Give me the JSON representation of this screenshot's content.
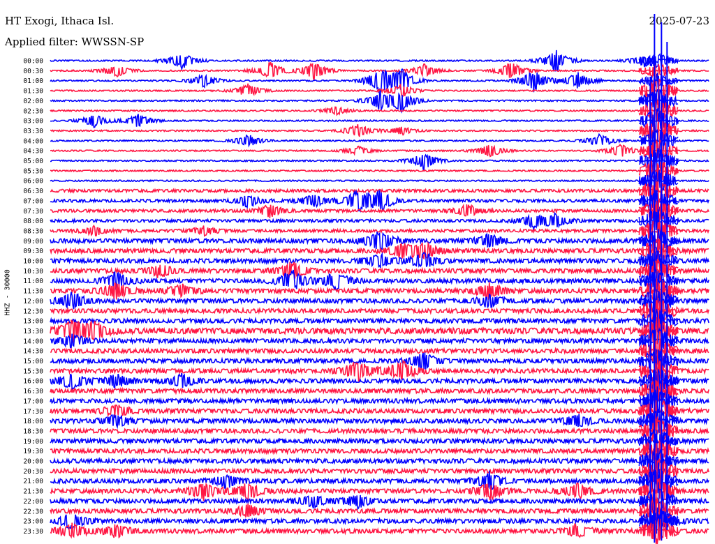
{
  "header": {
    "station": "HT Exogi, Ithaca Isl.",
    "filter": "Applied filter: WWSSN-SP",
    "date": "2025-07-23"
  },
  "side_label": "HHZ - 30000",
  "chart_data": {
    "type": "line",
    "title": "HT Exogi, Ithaca Isl.",
    "subtitle": "Applied filter: WWSSN-SP",
    "date": "2025-07-23",
    "ylabel": "HHZ - 30000",
    "xlabel": "",
    "series_colors": [
      "#0000ff",
      "#ff1744"
    ],
    "rows": [
      "00:00",
      "00:30",
      "01:00",
      "01:30",
      "02:00",
      "02:30",
      "03:00",
      "03:30",
      "04:00",
      "04:30",
      "05:00",
      "05:30",
      "06:00",
      "06:30",
      "07:00",
      "07:30",
      "08:00",
      "08:30",
      "09:00",
      "09:30",
      "10:00",
      "10:30",
      "11:00",
      "11:30",
      "12:00",
      "12:30",
      "13:00",
      "13:30",
      "14:00",
      "14:30",
      "15:00",
      "15:30",
      "16:00",
      "16:30",
      "17:00",
      "17:30",
      "18:00",
      "18:30",
      "19:00",
      "19:30",
      "20:00",
      "20:30",
      "21:00",
      "21:30",
      "22:00",
      "22:30",
      "23:00",
      "23:30"
    ],
    "noise_level": [
      1,
      1,
      1,
      1,
      1,
      1,
      1,
      1,
      1,
      1,
      1,
      1,
      1,
      2,
      2,
      2,
      2,
      2,
      3,
      3,
      3,
      3,
      3,
      3,
      3,
      3,
      3,
      4,
      3,
      3,
      3,
      3,
      3,
      3,
      3,
      3,
      3,
      3,
      3,
      3,
      3,
      3,
      3,
      3,
      3,
      3,
      3,
      3
    ],
    "events": [
      {
        "row": 0,
        "minute": 6,
        "amp": 4
      },
      {
        "row": 0,
        "minute": 23,
        "amp": 5
      },
      {
        "row": 0,
        "minute": 27,
        "amp": 3
      },
      {
        "row": 1,
        "minute": 3,
        "amp": 3
      },
      {
        "row": 1,
        "minute": 10,
        "amp": 4
      },
      {
        "row": 1,
        "minute": 12,
        "amp": 4
      },
      {
        "row": 1,
        "minute": 17,
        "amp": 3
      },
      {
        "row": 1,
        "minute": 21,
        "amp": 4
      },
      {
        "row": 2,
        "minute": 7,
        "amp": 3
      },
      {
        "row": 2,
        "minute": 15,
        "amp": 6
      },
      {
        "row": 2,
        "minute": 16,
        "amp": 5
      },
      {
        "row": 2,
        "minute": 22,
        "amp": 5
      },
      {
        "row": 2,
        "minute": 24,
        "amp": 4
      },
      {
        "row": 3,
        "minute": 9,
        "amp": 3
      },
      {
        "row": 3,
        "minute": 16,
        "amp": 3
      },
      {
        "row": 4,
        "minute": 15,
        "amp": 4
      },
      {
        "row": 4,
        "minute": 16,
        "amp": 5
      },
      {
        "row": 5,
        "minute": 13,
        "amp": 2
      },
      {
        "row": 6,
        "minute": 2,
        "amp": 3
      },
      {
        "row": 6,
        "minute": 4,
        "amp": 3
      },
      {
        "row": 7,
        "minute": 14,
        "amp": 3
      },
      {
        "row": 7,
        "minute": 16,
        "amp": 2
      },
      {
        "row": 8,
        "minute": 9,
        "amp": 3
      },
      {
        "row": 8,
        "minute": 25,
        "amp": 3
      },
      {
        "row": 9,
        "minute": 14,
        "amp": 2
      },
      {
        "row": 9,
        "minute": 20,
        "amp": 3
      },
      {
        "row": 9,
        "minute": 26,
        "amp": 3
      },
      {
        "row": 10,
        "minute": 17,
        "amp": 4
      },
      {
        "row": 14,
        "minute": 9,
        "amp": 3
      },
      {
        "row": 14,
        "minute": 12,
        "amp": 3
      },
      {
        "row": 14,
        "minute": 14,
        "amp": 5
      },
      {
        "row": 14,
        "minute": 15,
        "amp": 5
      },
      {
        "row": 15,
        "minute": 10,
        "amp": 3
      },
      {
        "row": 15,
        "minute": 19,
        "amp": 3
      },
      {
        "row": 16,
        "minute": 22,
        "amp": 3
      },
      {
        "row": 16,
        "minute": 23,
        "amp": 3
      },
      {
        "row": 17,
        "minute": 2,
        "amp": 2
      },
      {
        "row": 17,
        "minute": 7,
        "amp": 2
      },
      {
        "row": 18,
        "minute": 15,
        "amp": 5
      },
      {
        "row": 18,
        "minute": 20,
        "amp": 3
      },
      {
        "row": 19,
        "minute": 16,
        "amp": 3
      },
      {
        "row": 19,
        "minute": 17,
        "amp": 4
      },
      {
        "row": 20,
        "minute": 15,
        "amp": 3
      },
      {
        "row": 20,
        "minute": 17,
        "amp": 4
      },
      {
        "row": 21,
        "minute": 5,
        "amp": 3
      },
      {
        "row": 21,
        "minute": 11,
        "amp": 4
      },
      {
        "row": 22,
        "minute": 3,
        "amp": 4
      },
      {
        "row": 22,
        "minute": 11,
        "amp": 5
      },
      {
        "row": 22,
        "minute": 13,
        "amp": 4
      },
      {
        "row": 23,
        "minute": 3,
        "amp": 4
      },
      {
        "row": 23,
        "minute": 6,
        "amp": 3
      },
      {
        "row": 23,
        "minute": 20,
        "amp": 4
      },
      {
        "row": 24,
        "minute": 1,
        "amp": 4
      },
      {
        "row": 24,
        "minute": 20,
        "amp": 3
      },
      {
        "row": 27,
        "minute": 1,
        "amp": 5
      },
      {
        "row": 27,
        "minute": 2,
        "amp": 4
      },
      {
        "row": 28,
        "minute": 1,
        "amp": 3
      },
      {
        "row": 30,
        "minute": 17,
        "amp": 4
      },
      {
        "row": 31,
        "minute": 14,
        "amp": 5
      },
      {
        "row": 31,
        "minute": 16,
        "amp": 5
      },
      {
        "row": 32,
        "minute": 1,
        "amp": 4
      },
      {
        "row": 32,
        "minute": 3,
        "amp": 3
      },
      {
        "row": 32,
        "minute": 6,
        "amp": 3
      },
      {
        "row": 35,
        "minute": 3,
        "amp": 3
      },
      {
        "row": 36,
        "minute": 3,
        "amp": 3
      },
      {
        "row": 36,
        "minute": 24,
        "amp": 3
      },
      {
        "row": 42,
        "minute": 8,
        "amp": 3
      },
      {
        "row": 42,
        "minute": 20,
        "amp": 4
      },
      {
        "row": 43,
        "minute": 7,
        "amp": 4
      },
      {
        "row": 43,
        "minute": 9,
        "amp": 4
      },
      {
        "row": 43,
        "minute": 20,
        "amp": 4
      },
      {
        "row": 43,
        "minute": 24,
        "amp": 4
      },
      {
        "row": 44,
        "minute": 12,
        "amp": 3
      },
      {
        "row": 44,
        "minute": 14,
        "amp": 3
      },
      {
        "row": 45,
        "minute": 9,
        "amp": 3
      },
      {
        "row": 46,
        "minute": 1,
        "amp": 4
      },
      {
        "row": 46,
        "minute": 28,
        "amp": 3
      },
      {
        "row": 47,
        "minute": 1,
        "amp": 4
      },
      {
        "row": 47,
        "minute": 3,
        "amp": 3
      },
      {
        "row": 47,
        "minute": 24,
        "amp": 3
      }
    ],
    "large_event": {
      "start_row": 0,
      "minute": 27.5,
      "amp": 12
    }
  }
}
